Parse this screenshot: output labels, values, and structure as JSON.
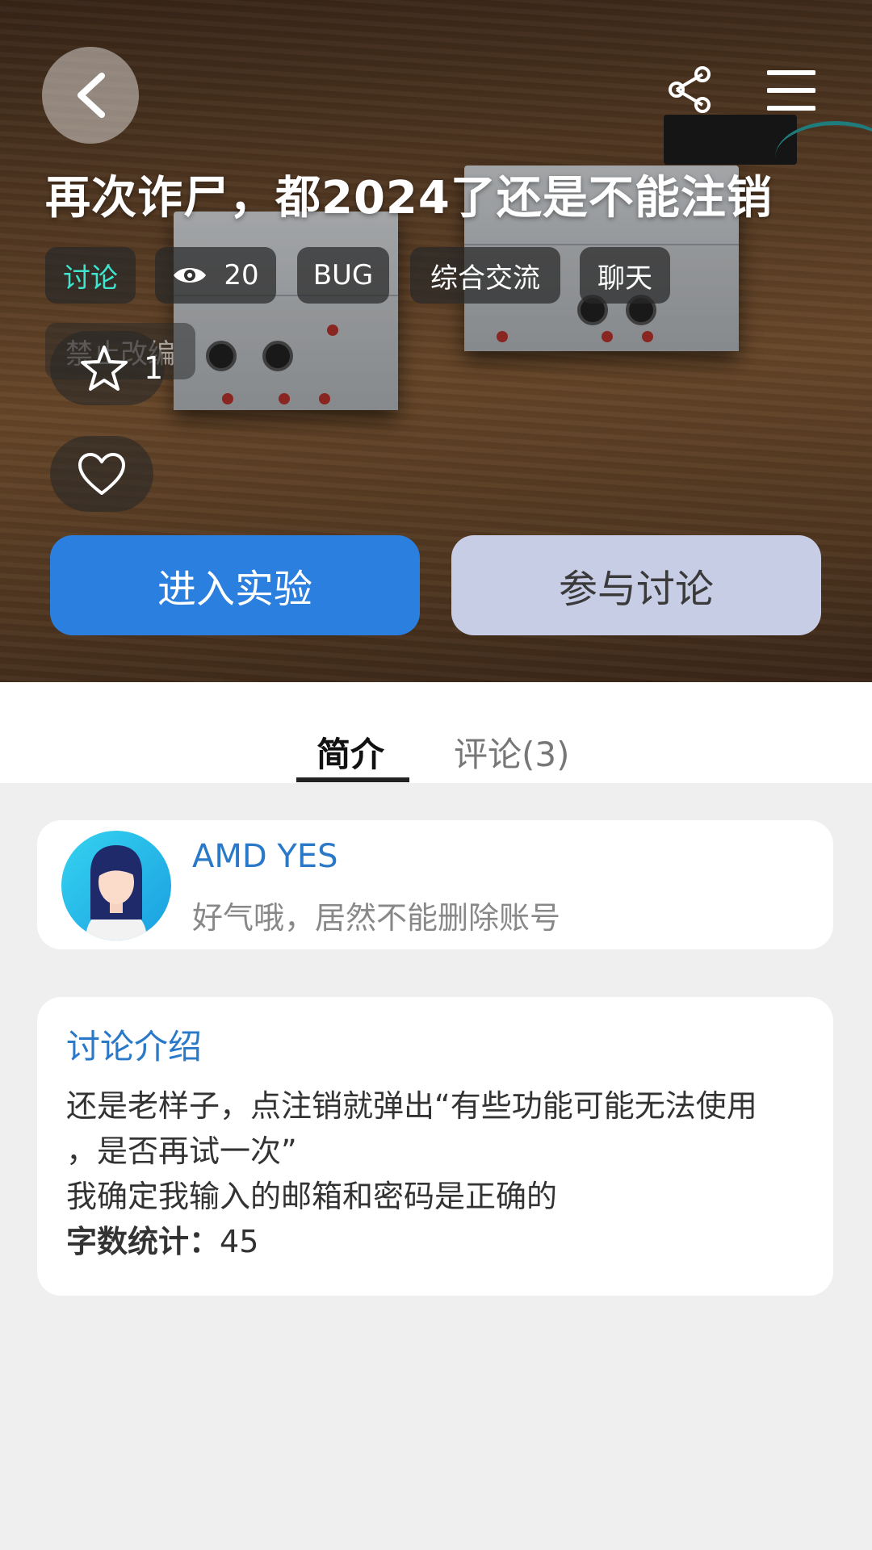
{
  "header": {
    "title": "再次诈尸，都2024了还是不能注销",
    "back_icon": "chevron-left-icon",
    "share_icon": "share-icon",
    "menu_icon": "hamburger-menu-icon"
  },
  "tags": {
    "category": "讨论",
    "views": "20",
    "items": [
      "BUG",
      "综合交流",
      "聊天"
    ],
    "restriction": "禁止改编"
  },
  "stats": {
    "favorites": "1"
  },
  "actions": {
    "enter_label": "进入实验",
    "discuss_label": "参与讨论"
  },
  "tabs": {
    "intro_label": "简介",
    "comments_label": "评论(3)"
  },
  "author": {
    "name": "AMD YES",
    "bio": "好气哦，居然不能删除账号"
  },
  "intro": {
    "heading": "讨论介绍",
    "body": "还是老样子，点注销就弹出“有些功能可能无法使用\n，是否再试一次”\n我确定我输入的邮箱和密码是正确的",
    "word_count_label": "字数统计：",
    "word_count": "45"
  },
  "colors": {
    "primary": "#2b7fde",
    "secondary_button": "#c8cde6",
    "category_tag": "#3ee6cf",
    "link_blue": "#2a78c8"
  }
}
